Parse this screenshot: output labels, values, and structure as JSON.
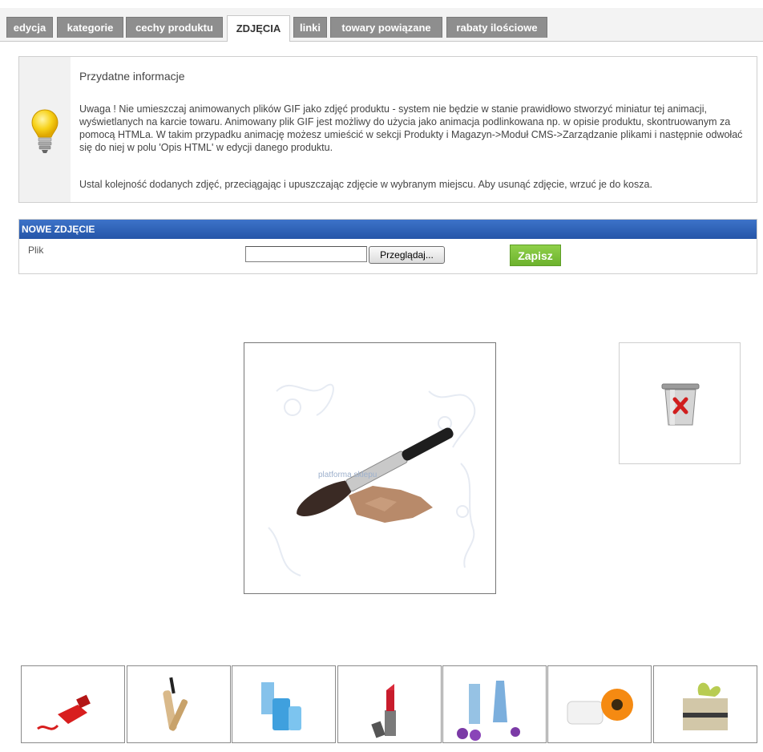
{
  "tabs": [
    {
      "label": "edycja",
      "active": false
    },
    {
      "label": "kategorie",
      "active": false
    },
    {
      "label": "cechy produktu",
      "active": false
    },
    {
      "label": "ZDJĘCIA",
      "active": true
    },
    {
      "label": "linki",
      "active": false
    },
    {
      "label": "towary powiązane",
      "active": false
    },
    {
      "label": "rabaty ilościowe",
      "active": false
    }
  ],
  "info": {
    "icon": "lightbulb-icon",
    "title": "Przydatne informacje",
    "paragraph1": "Uwaga ! Nie umieszczaj animowanych plików GIF jako zdjęć produktu - system nie będzie w stanie prawidłowo stworzyć miniatur tej animacji, wyświetlanych na karcie towaru. Animowany plik GIF jest możliwy do użycia jako animacja podlinkowana np. w opisie produktu, skontruowanym za pomocą HTMLa. W takim przypadku animację możesz umieścić w sekcji Produkty i Magazyn->Moduł CMS->Zarządzanie plikami i następnie odwołać się do niej w polu 'Opis HTML' w edycji danego produktu.",
    "paragraph2": "Ustal kolejność dodanych zdjęć, przeciągając i upuszczając zdjęcie w wybranym miejscu. Aby usunąć zdjęcie, wrzuć je do kosza."
  },
  "new_photo": {
    "header": "NOWE ZDJĘCIE",
    "file_label": "Plik",
    "file_value": "",
    "browse_label": "Przeglądaj...",
    "save_label": "Zapisz"
  },
  "main_photo": {
    "watermark": "platforma sklepu",
    "subject": "makeup-brush-powder"
  },
  "trash": {
    "icon": "trash-delete-icon"
  },
  "thumbnails": [
    {
      "subject": "red-nail-polish"
    },
    {
      "subject": "mascara"
    },
    {
      "subject": "blue-cosmetic-bottles"
    },
    {
      "subject": "lipstick"
    },
    {
      "subject": "perfume-bottles-flowers"
    },
    {
      "subject": "cream-jar-flower"
    },
    {
      "subject": "soap-with-flower"
    }
  ],
  "colors": {
    "tab_bg": "#8e8e8e",
    "header_blue": "#2f63b8",
    "save_green": "#7bc33a"
  }
}
